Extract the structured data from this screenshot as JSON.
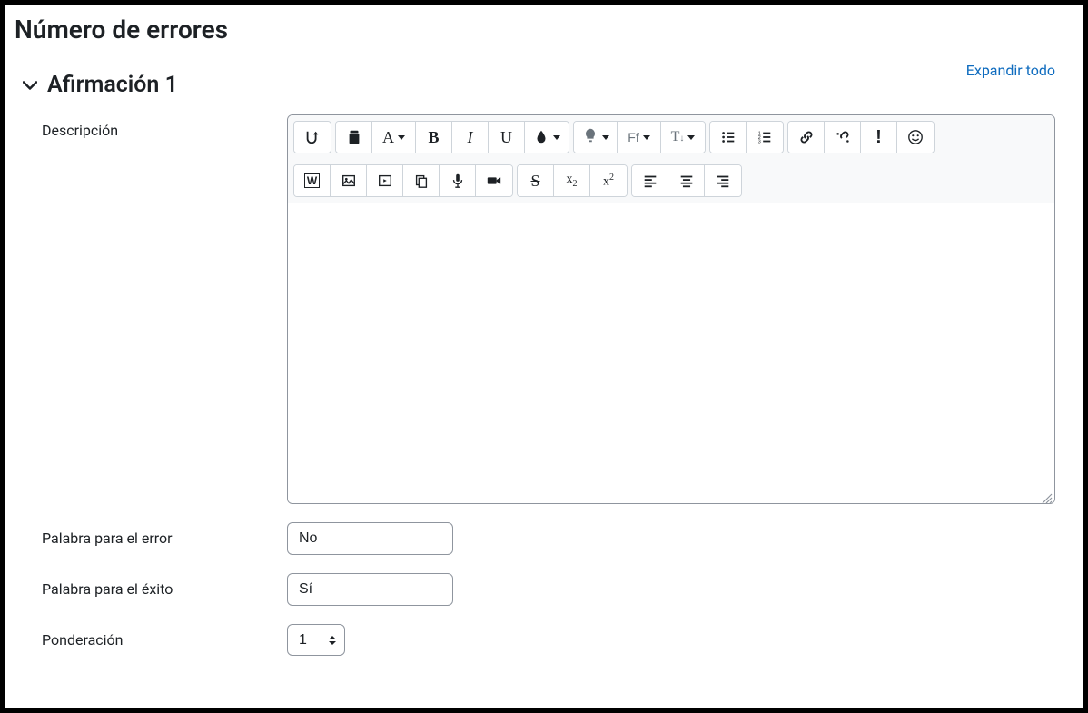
{
  "page": {
    "title": "Número de errores",
    "expand_all": "Expandir todo"
  },
  "section": {
    "title": "Afirmación 1"
  },
  "fields": {
    "description_label": "Descripción",
    "error_word_label": "Palabra para el error",
    "error_word_value": "No",
    "success_word_label": "Palabra para el éxito",
    "success_word_value": "Sí",
    "weight_label": "Ponderación",
    "weight_value": "1"
  },
  "toolbar": {
    "toggle": "toggle-toolbar",
    "font_letter": "A",
    "bold": "B",
    "italic": "I",
    "underline": "U",
    "ff_label": "Ff",
    "t_label": "T",
    "strike": "S",
    "sub": "x₂",
    "sup": "x²",
    "w_label": "W"
  }
}
